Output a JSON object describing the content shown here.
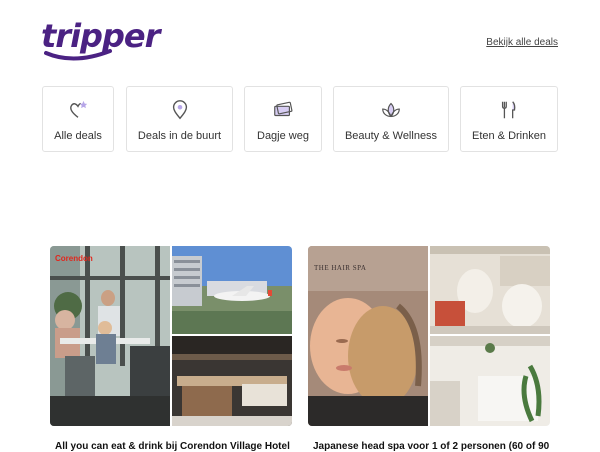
{
  "header": {
    "logo_text": "tripper",
    "all_deals_link": "Bekijk alle deals",
    "brand_color": "#4b2283"
  },
  "categories": [
    {
      "label": "Alle deals",
      "icon": "heart-star-icon"
    },
    {
      "label": "Deals in de buurt",
      "icon": "map-pin-icon"
    },
    {
      "label": "Dagje weg",
      "icon": "tickets-icon"
    },
    {
      "label": "Beauty & Wellness",
      "icon": "lotus-icon"
    },
    {
      "label": "Eten & Drinken",
      "icon": "fork-knife-icon"
    }
  ],
  "deals": [
    {
      "title": "All you can eat & drink bij Corendon Village Hotel",
      "brand_mark": "Corendon"
    },
    {
      "title": "Japanese head spa voor 1 of 2 personen (60 of 90",
      "brand_mark": "THE HAIR SPA"
    }
  ]
}
